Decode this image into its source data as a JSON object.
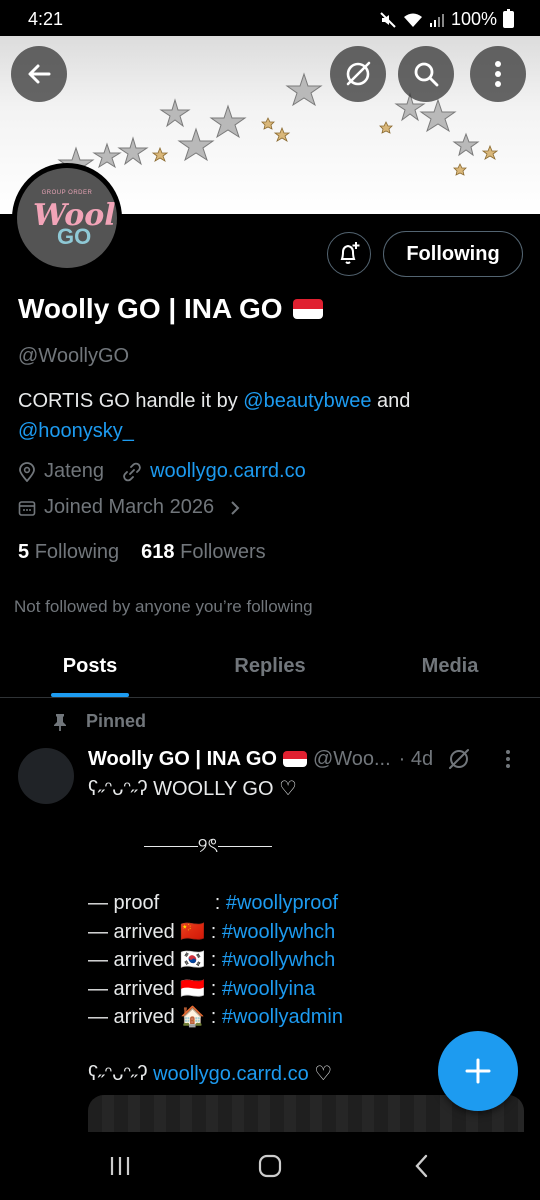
{
  "status_bar": {
    "time": "4:21",
    "battery": "100%"
  },
  "profile": {
    "display_name": "Woolly GO | INA GO",
    "handle": "@WoollyGO",
    "bio_text": "CORTIS GO handle it by ",
    "bio_mention_1": "@beautybwee",
    "bio_and": " and",
    "bio_mention_2": "@hoonysky_",
    "location": "Jateng",
    "website": "woollygo.carrd.co",
    "joined": "Joined March 2026",
    "following_count": "5",
    "following_label": "Following",
    "followers_count": "618",
    "followers_label": "Followers",
    "not_followed": "Not followed by anyone you’re following",
    "follow_button": "Following",
    "avatar_logo": {
      "top": "GROUP ORDER",
      "word": "Woolly",
      "sub": "GO"
    }
  },
  "tabs": [
    {
      "label": "Posts",
      "active": true
    },
    {
      "label": "Replies",
      "active": false
    },
    {
      "label": "Media",
      "active": false
    }
  ],
  "pinned_post": {
    "pinned_label": "Pinned",
    "author": "Woolly GO | INA GO",
    "handle": "@Woo...",
    "time": "· 4d",
    "line_1": "ʕ˶ᵔᴗᵔ˶ʔ WOOLLY GO ♡",
    "divider_glyph": "୨ৎ",
    "rows": [
      {
        "label": "— proof          : ",
        "tag": "#woollyproof"
      },
      {
        "label": "— arrived 🇨🇳 : ",
        "tag": "#woollywhch"
      },
      {
        "label": "— arrived 🇰🇷 : ",
        "tag": "#woollywhch"
      },
      {
        "label": "— arrived 🇮🇩 : ",
        "tag": "#woollyina"
      },
      {
        "label": "— arrived 🏠 : ",
        "tag": "#woollyadmin"
      }
    ],
    "footer_prefix": "ʕ˶ᵔᴗᵔ˶ʔ ",
    "footer_link": "woollygo.carrd.co",
    "footer_suffix": " ♡"
  },
  "colors": {
    "accent": "#1d9bf0",
    "muted": "#71767b",
    "background": "#000000"
  }
}
